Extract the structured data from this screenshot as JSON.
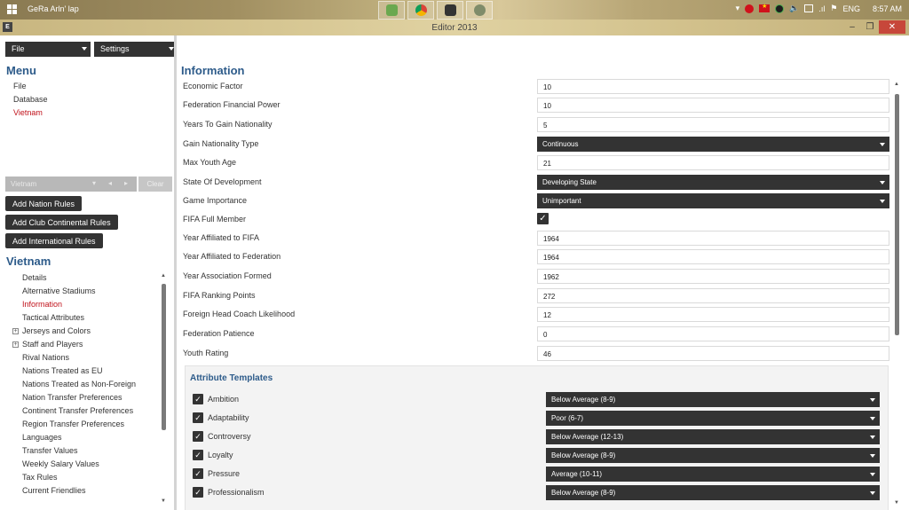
{
  "taskbar": {
    "title": "GeRa Arln' lap",
    "lang": "ENG",
    "time": "8:57 AM",
    "apps": [
      "game-icon",
      "chrome-icon",
      "editor-icon",
      "tool-icon"
    ]
  },
  "window": {
    "title": "Editor 2013",
    "app_icon": "E"
  },
  "left": {
    "file_dd": "File",
    "settings_dd": "Settings",
    "menu_header": "Menu",
    "menu_items": [
      "File",
      "Database",
      "Vietnam"
    ],
    "filter_value": "Vietnam",
    "clear_label": "Clear",
    "buttons": [
      "Add Nation Rules",
      "Add Club Continental Rules",
      "Add International Rules"
    ],
    "nation_header": "Vietnam",
    "nav_items": [
      "Details",
      "Alternative Stadiums",
      "Information",
      "Tactical Attributes",
      "Jerseys and Colors",
      "Staff and Players",
      "Rival Nations",
      "Nations Treated as EU",
      "Nations Treated as Non-Foreign",
      "Nation Transfer Preferences",
      "Continent Transfer Preferences",
      "Region Transfer Preferences",
      "Languages",
      "Transfer Values",
      "Weekly Salary Values",
      "Tax Rules",
      "Current Friendlies"
    ]
  },
  "info": {
    "title": "Information",
    "rows": [
      {
        "label": "Economic Factor",
        "value": "10"
      },
      {
        "label": "Federation Financial Power",
        "value": "10"
      },
      {
        "label": "Years To Gain Nationality",
        "value": "5"
      },
      {
        "label": "Gain Nationality Type",
        "value": "Continuous"
      },
      {
        "label": "Max Youth Age",
        "value": "21"
      },
      {
        "label": "State Of Development",
        "value": "Developing State"
      },
      {
        "label": "Game Importance",
        "value": "Unimportant"
      },
      {
        "label": "FIFA Full Member",
        "value": "✓"
      },
      {
        "label": "Year Affiliated to FIFA",
        "value": "1964"
      },
      {
        "label": "Year Affiliated to Federation",
        "value": "1964"
      },
      {
        "label": "Year Association Formed",
        "value": "1962"
      },
      {
        "label": "FIFA Ranking Points",
        "value": "272"
      },
      {
        "label": "Foreign Head Coach Likelihood",
        "value": "12"
      },
      {
        "label": "Federation Patience",
        "value": "0"
      },
      {
        "label": "Youth Rating",
        "value": "46"
      }
    ],
    "attr_title": "Attribute Templates",
    "attributes": [
      {
        "label": "Ambition",
        "value": "Below Average (8-9)"
      },
      {
        "label": "Adaptability",
        "value": "Poor (6-7)"
      },
      {
        "label": "Controversy",
        "value": "Below Average (12-13)"
      },
      {
        "label": "Loyalty",
        "value": "Below Average (8-9)"
      },
      {
        "label": "Pressure",
        "value": "Average (10-11)"
      },
      {
        "label": "Professionalism",
        "value": "Below Average (8-9)"
      }
    ]
  }
}
